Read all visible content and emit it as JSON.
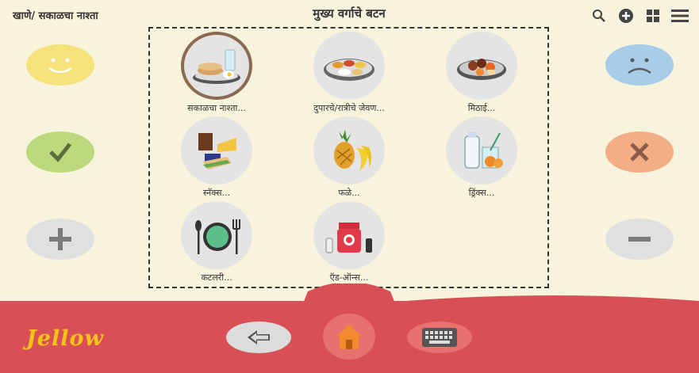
{
  "header": {
    "breadcrumb": "खाणे/ सकाळचा नाश्ता",
    "title": "मुख्य वर्गाचे बटन",
    "icons": [
      "search-icon",
      "add-icon",
      "grid-icon",
      "menu-icon"
    ]
  },
  "categories": [
    {
      "label": "सकाळचा नाश्ता...",
      "selected": true
    },
    {
      "label": "दुपारचे/रात्रीचे जेवण...",
      "selected": false
    },
    {
      "label": "मिठाई...",
      "selected": false
    },
    {
      "label": "स्नॅक्स...",
      "selected": false
    },
    {
      "label": "फळे...",
      "selected": false
    },
    {
      "label": "ड्रिंक्स...",
      "selected": false
    },
    {
      "label": "कटलरी...",
      "selected": false
    },
    {
      "label": "ऍड-ऑन्स...",
      "selected": false
    }
  ],
  "side_buttons": {
    "left": [
      "like-button",
      "yes-button",
      "more-button"
    ],
    "right": [
      "dislike-button",
      "no-button",
      "less-button"
    ]
  },
  "footer": {
    "logo": "Jellow",
    "buttons": [
      "back-button",
      "home-button",
      "keyboard-button"
    ]
  },
  "colors": {
    "background": "#f8f3dd",
    "footer": "#d94f56",
    "like": "#f6e27a",
    "yes": "#bcd97c",
    "more": "#e0e0e0",
    "dislike": "#a7cde8",
    "no": "#f4ae86",
    "less": "#e0e0e0",
    "logo": "#f3c316"
  }
}
